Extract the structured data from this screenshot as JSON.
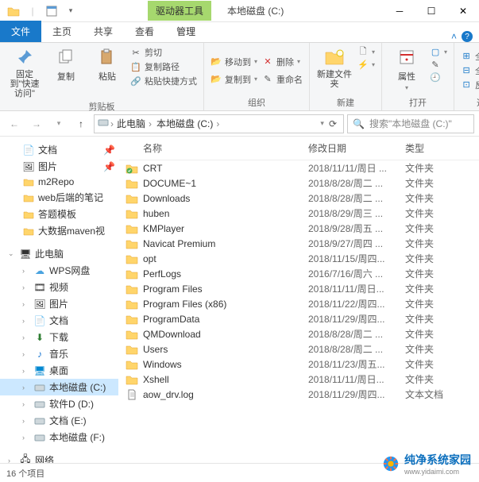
{
  "title": "本地磁盘 (C:)",
  "context_tab": "驱动器工具",
  "tabs": {
    "file": "文件",
    "home": "主页",
    "share": "共享",
    "view": "查看",
    "manage": "管理"
  },
  "ribbon": {
    "pin": "固定到\"快速访问\"",
    "copy": "复制",
    "paste": "粘贴",
    "cut": "剪切",
    "copypath": "复制路径",
    "pasteshortcut": "粘贴快捷方式",
    "group_clipboard": "剪贴板",
    "moveto": "移动到",
    "copyto": "复制到",
    "delete": "删除",
    "rename": "重命名",
    "group_org": "组织",
    "newfolder": "新建文件夹",
    "group_new": "新建",
    "properties": "属性",
    "group_open": "打开",
    "selectall": "全部选择",
    "selectnone": "全部取消",
    "invert": "反向选择",
    "group_select": "选择"
  },
  "breadcrumb": {
    "pc": "此电脑",
    "drive": "本地磁盘 (C:)"
  },
  "search_placeholder": "搜索\"本地磁盘 (C:)\"",
  "sidebar": {
    "docs": "文档",
    "pics": "图片",
    "m2repo": "m2Repo",
    "webnotes": "web后端的笔记",
    "answertpl": "答题模板",
    "bigdata": "大数据maven视",
    "thispc": "此电脑",
    "wps": "WPS网盘",
    "video": "视频",
    "pics2": "图片",
    "docs2": "文档",
    "down": "下载",
    "music": "音乐",
    "desktop": "桌面",
    "cdrive": "本地磁盘 (C:)",
    "ddrive": "软件D (D:)",
    "edrive": "文档 (E:)",
    "fdrive": "本地磁盘 (F:)",
    "network": "网络"
  },
  "columns": {
    "name": "名称",
    "date": "修改日期",
    "type": "类型"
  },
  "type_folder": "文件夹",
  "type_txt": "文本文档",
  "files": [
    {
      "name": "CRT",
      "date": "2018/11/11/周日 ...",
      "type": "文件夹",
      "icon": "folder-check"
    },
    {
      "name": "DOCUME~1",
      "date": "2018/8/28/周二 ...",
      "type": "文件夹",
      "icon": "folder"
    },
    {
      "name": "Downloads",
      "date": "2018/8/28/周二 ...",
      "type": "文件夹",
      "icon": "folder"
    },
    {
      "name": "huben",
      "date": "2018/8/29/周三 ...",
      "type": "文件夹",
      "icon": "folder"
    },
    {
      "name": "KMPlayer",
      "date": "2018/9/28/周五 ...",
      "type": "文件夹",
      "icon": "folder"
    },
    {
      "name": "Navicat Premium",
      "date": "2018/9/27/周四 ...",
      "type": "文件夹",
      "icon": "folder"
    },
    {
      "name": "opt",
      "date": "2018/11/15/周四...",
      "type": "文件夹",
      "icon": "folder"
    },
    {
      "name": "PerfLogs",
      "date": "2016/7/16/周六 ...",
      "type": "文件夹",
      "icon": "folder"
    },
    {
      "name": "Program Files",
      "date": "2018/11/11/周日...",
      "type": "文件夹",
      "icon": "folder"
    },
    {
      "name": "Program Files (x86)",
      "date": "2018/11/22/周四...",
      "type": "文件夹",
      "icon": "folder"
    },
    {
      "name": "ProgramData",
      "date": "2018/11/29/周四...",
      "type": "文件夹",
      "icon": "folder"
    },
    {
      "name": "QMDownload",
      "date": "2018/8/28/周二 ...",
      "type": "文件夹",
      "icon": "folder"
    },
    {
      "name": "Users",
      "date": "2018/8/28/周二 ...",
      "type": "文件夹",
      "icon": "folder"
    },
    {
      "name": "Windows",
      "date": "2018/11/23/周五...",
      "type": "文件夹",
      "icon": "folder"
    },
    {
      "name": "Xshell",
      "date": "2018/11/11/周日...",
      "type": "文件夹",
      "icon": "folder"
    },
    {
      "name": "aow_drv.log",
      "date": "2018/11/29/周四...",
      "type": "文本文档",
      "icon": "file"
    }
  ],
  "status": "16 个项目",
  "watermark": {
    "brand": "纯净系统家园",
    "url": "www.yidaimi.com"
  }
}
